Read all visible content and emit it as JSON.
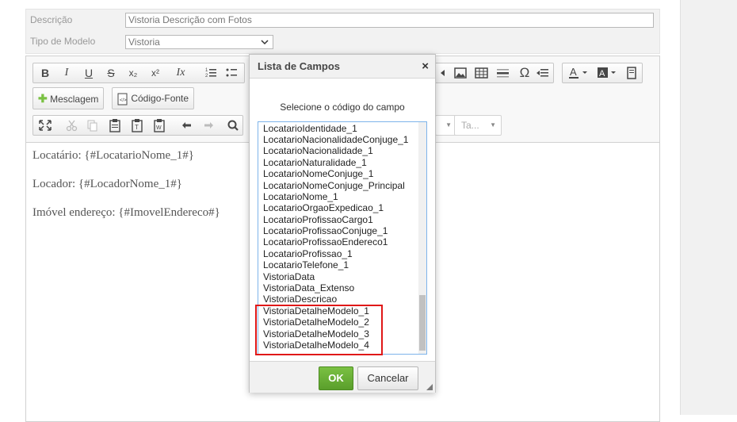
{
  "form": {
    "descricao_label": "Descrição",
    "descricao_value": "Vistoria Descrição com Fotos",
    "tipo_label": "Tipo de Modelo",
    "tipo_value": "Vistoria"
  },
  "toolbar": {
    "row1": {
      "bold": "B",
      "italic": "I",
      "underline": "U",
      "strike": "S",
      "subscript": "x₂",
      "superscript": "x²",
      "remove_format": "Ix",
      "special_char": "Ω"
    },
    "mesclagem_label": "Mesclagem",
    "codigo_fonte_label": "Código-Fonte",
    "combo_size_label": "Ta..."
  },
  "content": {
    "lines": [
      "Locatário: {#LocatarioNome_1#}",
      "Locador: {#LocadorNome_1#}",
      "Imóvel endereço: {#ImovelEndereco#}"
    ]
  },
  "dialog": {
    "title": "Lista de Campos",
    "close_label": "×",
    "subtitle": "Selecione o código do campo",
    "items": [
      "LocatarioIdentidade_1",
      "LocatarioNacionalidadeConjuge_1",
      "LocatarioNacionalidade_1",
      "LocatarioNaturalidade_1",
      "LocatarioNomeConjuge_1",
      "LocatarioNomeConjuge_Principal",
      "LocatarioNome_1",
      "LocatarioOrgaoExpedicao_1",
      "LocatarioProfissaoCargo1",
      "LocatarioProfissaoConjuge_1",
      "LocatarioProfissaoEndereco1",
      "LocatarioProfissao_1",
      "LocatarioTelefone_1",
      "VistoriaData",
      "VistoriaData_Extenso",
      "VistoriaDescricao",
      "VistoriaDetalheModelo_1",
      "VistoriaDetalheModelo_2",
      "VistoriaDetalheModelo_3",
      "VistoriaDetalheModelo_4"
    ],
    "ok_label": "OK",
    "cancel_label": "Cancelar"
  },
  "colors": {
    "ok_green": "#6cb338",
    "highlight_red": "#e01818",
    "list_border": "#7eb4ea"
  }
}
